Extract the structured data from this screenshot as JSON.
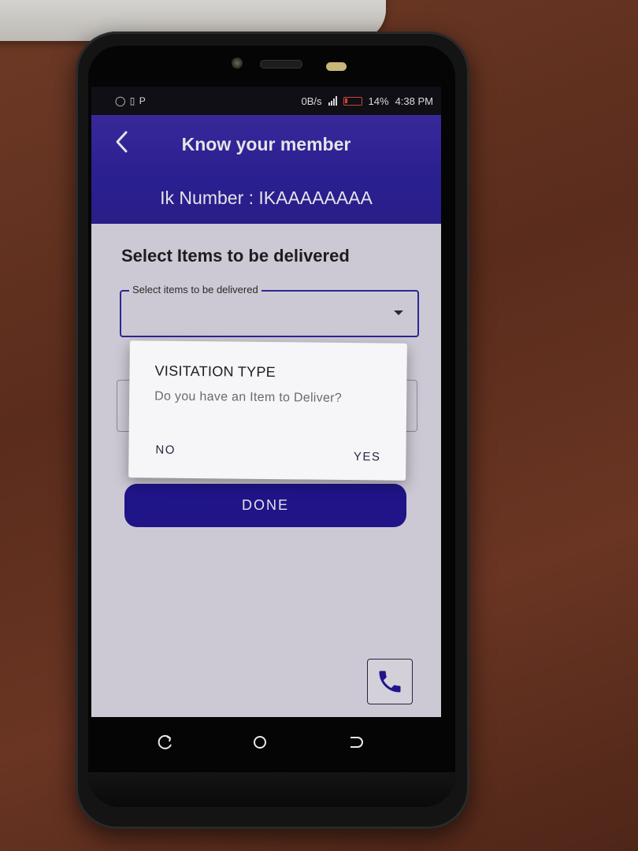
{
  "status_bar": {
    "icons": "◯ ▯ P",
    "net_speed": "0B/s",
    "battery_level": "14%",
    "time": "4:38 PM"
  },
  "header": {
    "title": "Know your member",
    "ik_number": "Ik Number : IKAAAAAAAA"
  },
  "form": {
    "section_title": "Select Items to be delivered",
    "items_dropdown_label": "Select items to be delivered",
    "done_label": "DONE"
  },
  "dialog": {
    "title": "VISITATION TYPE",
    "message": "Do you have an Item to Deliver?",
    "no_label": "NO",
    "yes_label": "YES"
  },
  "colors": {
    "primary": "#2a1f9c",
    "button": "#1f1394",
    "battery_low": "#e0493a"
  }
}
